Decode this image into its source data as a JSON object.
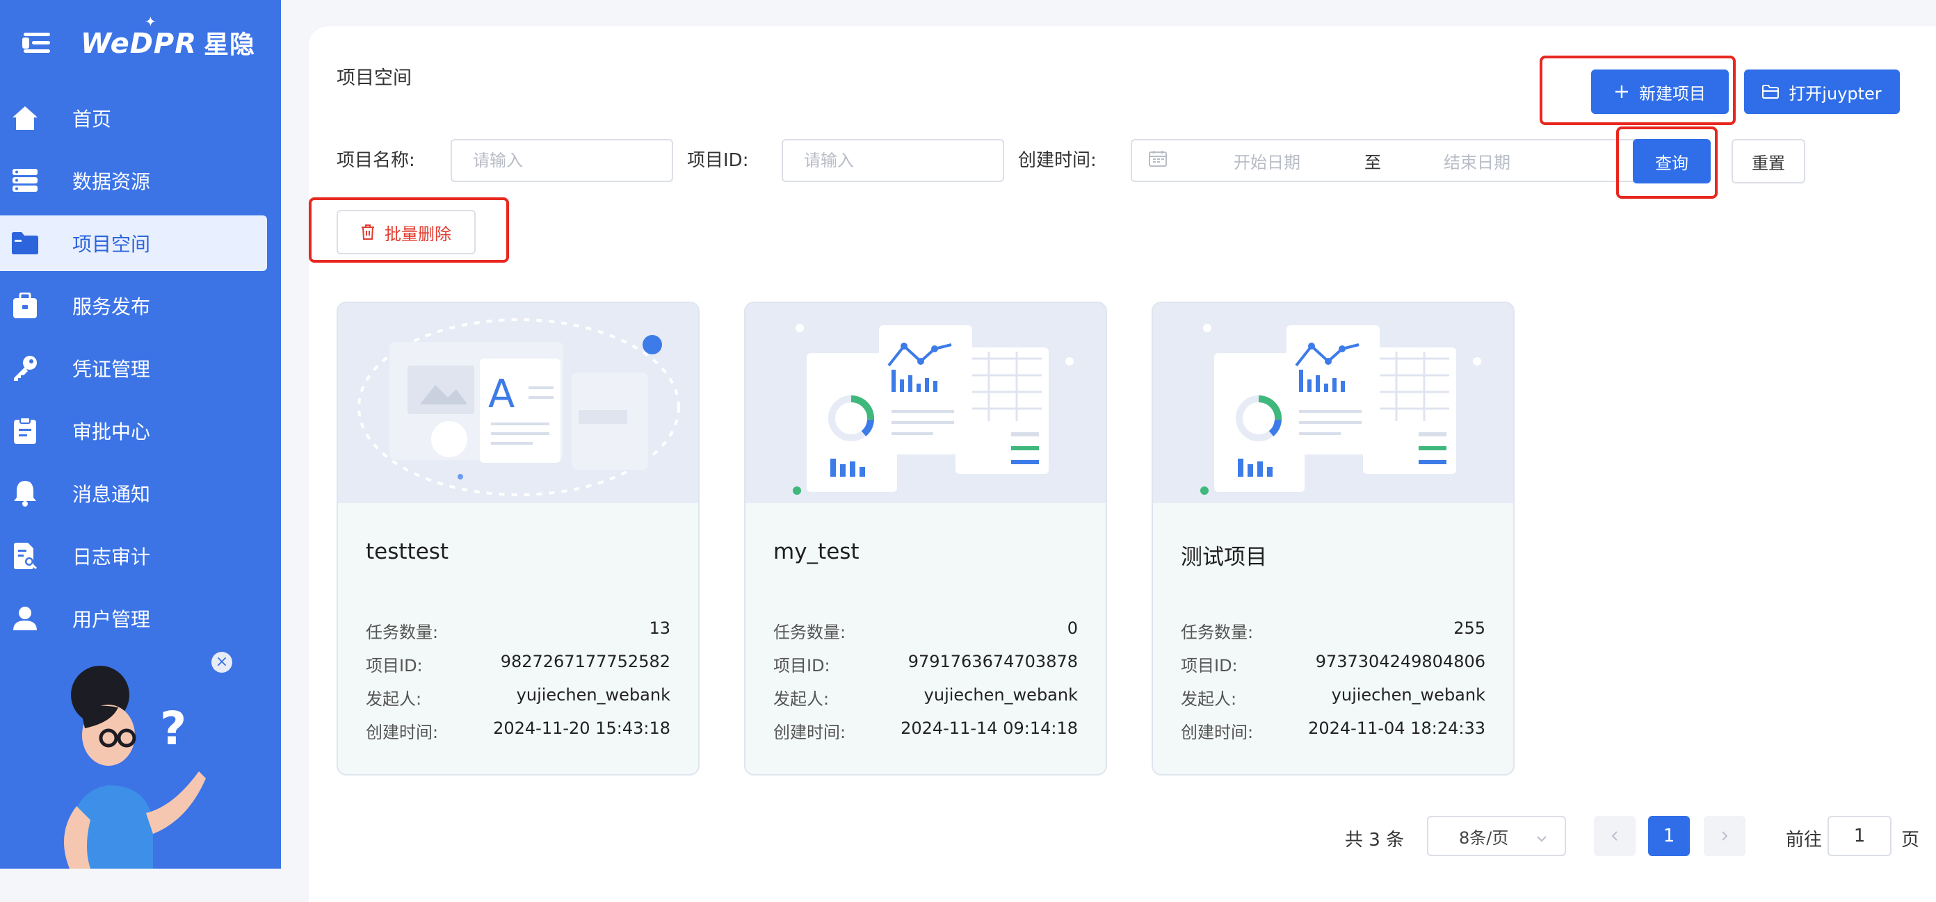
{
  "brand": {
    "logo": "WeDPR",
    "logo_cn": "星隐"
  },
  "sidebar": {
    "items": [
      {
        "label": "首页",
        "icon": "home-icon"
      },
      {
        "label": "数据资源",
        "icon": "database-icon"
      },
      {
        "label": "项目空间",
        "icon": "folder-icon",
        "active": true
      },
      {
        "label": "服务发布",
        "icon": "briefcase-icon"
      },
      {
        "label": "凭证管理",
        "icon": "key-icon"
      },
      {
        "label": "审批中心",
        "icon": "clipboard-icon"
      },
      {
        "label": "消息通知",
        "icon": "bell-icon"
      },
      {
        "label": "日志审计",
        "icon": "log-search-icon"
      },
      {
        "label": "用户管理",
        "icon": "user-icon"
      }
    ],
    "helper": {
      "close": "×",
      "mark": "?"
    }
  },
  "header": {
    "title": "项目空间",
    "new_project": "新建项目",
    "open_jupyter": "打开juypter"
  },
  "filters": {
    "name_label": "项目名称:",
    "name_placeholder": "请输入",
    "id_label": "项目ID:",
    "id_placeholder": "请输入",
    "time_label": "创建时间:",
    "start_placeholder": "开始日期",
    "separator": "至",
    "end_placeholder": "结束日期",
    "query": "查询",
    "reset": "重置",
    "batch_delete": "批量删除"
  },
  "card_labels": {
    "tasks": "任务数量:",
    "id": "项目ID:",
    "owner": "发起人:",
    "created": "创建时间:"
  },
  "projects": [
    {
      "name": "testtest",
      "tasks": "13",
      "id": "9827267177752582",
      "owner": "yujiechen_webank",
      "created": "2024-11-20 15:43:18"
    },
    {
      "name": "my_test",
      "tasks": "0",
      "id": "9791763674703878",
      "owner": "yujiechen_webank",
      "created": "2024-11-14 09:14:18"
    },
    {
      "name": "测试项目",
      "tasks": "255",
      "id": "9737304249804806",
      "owner": "yujiechen_webank",
      "created": "2024-11-04 18:24:33"
    }
  ],
  "pagination": {
    "total": "共 3 条",
    "page_size": "8条/页",
    "current": "1",
    "goto_label": "前往",
    "goto_value": "1",
    "page_suffix": "页"
  },
  "colors": {
    "sidebar": "#3c74e6",
    "primary": "#2f6ee8",
    "highlight": "#e8281f",
    "danger": "#e23b2e"
  }
}
